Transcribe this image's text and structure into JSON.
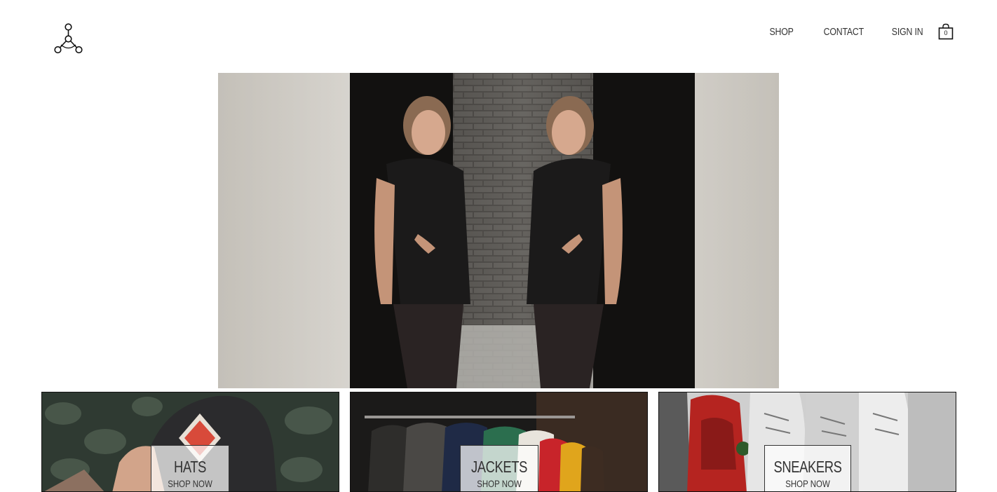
{
  "header": {
    "logo_icon": "molecule-tri-node-icon",
    "nav": [
      {
        "label": "SHOP"
      },
      {
        "label": "CONTACT"
      },
      {
        "label": "SIGN IN"
      }
    ],
    "cart": {
      "icon": "shopping-bag-icon",
      "count": "0"
    }
  },
  "hero": {
    "image": "mirrored-fashion-model-in-black-vest-against-white-stone-wall"
  },
  "categories": [
    {
      "title": "HATS",
      "cta": "SHOP NOW",
      "image": "hand-holding-grey-snapback-cap-with-badge"
    },
    {
      "title": "JACKETS",
      "cta": "SHOP NOW",
      "image": "clothing-rack-with-colorful-jackets"
    },
    {
      "title": "SNEAKERS",
      "cta": "SHOP NOW",
      "image": "row-of-red-and-white-sneakers"
    }
  ],
  "colors": {
    "text": "#333333",
    "border": "#111111"
  }
}
